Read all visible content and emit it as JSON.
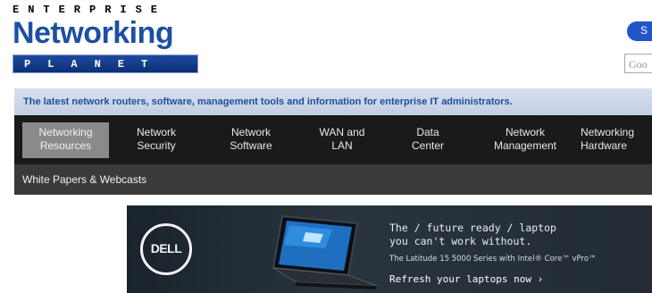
{
  "logo": {
    "top": "ENTERPRISE",
    "main": "Networking",
    "bottom": "PLANET"
  },
  "header": {
    "button_label": "S",
    "search_placeholder": "Goo"
  },
  "tagline": "The latest network routers, software, management tools and information for enterprise IT administrators.",
  "nav": {
    "items": [
      {
        "line1": "Networking",
        "line2": "Resources",
        "active": true
      },
      {
        "line1": "Network",
        "line2": "Security"
      },
      {
        "line1": "Network",
        "line2": "Software"
      },
      {
        "line1": "WAN and",
        "line2": "LAN"
      },
      {
        "line1": "Data",
        "line2": "Center"
      },
      {
        "line1": "Network",
        "line2": "Management"
      },
      {
        "line1": "Networking",
        "line2": "Hardware"
      }
    ],
    "subnav": [
      "White Papers & Webcasts"
    ]
  },
  "ad": {
    "brand": "DELL",
    "headline1": "The / future ready / laptop",
    "headline2": "you can't work without.",
    "subline": "The Latitude 15 5000 Series with Intel® Core™ vPro™",
    "cta": "Refresh your laptops now ›"
  },
  "colors": {
    "brand_blue": "#1d4fa3",
    "nav_bg": "#1a1a1a",
    "nav_active": "#8a8a8a",
    "subnav_bg": "#3a3a3a",
    "tagline_bg": "#c9d4e6"
  }
}
